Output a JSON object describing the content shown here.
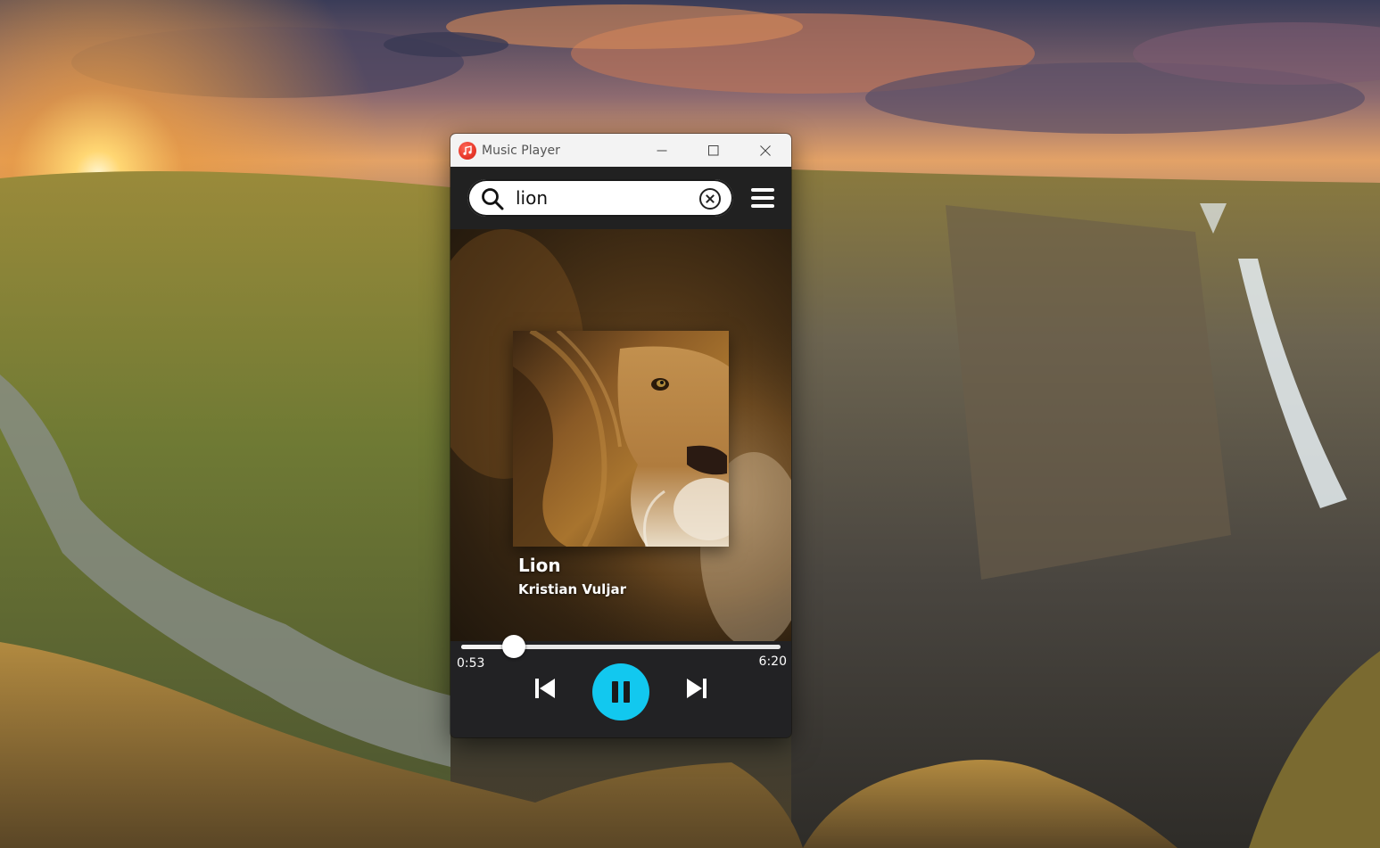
{
  "window": {
    "title": "Music Player"
  },
  "search": {
    "query": "lion",
    "placeholder": ""
  },
  "track": {
    "title": "Lion",
    "artist": "Kristian Vuljar"
  },
  "player": {
    "current_time": "0:53",
    "total_time": "6:20",
    "progress_fraction": 0.165,
    "state": "playing"
  },
  "icons": {
    "app": "music-note-icon",
    "minimize": "minimize-icon",
    "maximize": "maximize-icon",
    "close": "close-icon",
    "search": "search-icon",
    "clear": "clear-circle-x-icon",
    "menu": "hamburger-menu-icon",
    "previous": "skip-previous-icon",
    "pause": "pause-icon",
    "next": "skip-next-icon"
  },
  "colors": {
    "accent": "#12c8ef",
    "window_bg": "#222224",
    "titlebar_bg": "#f3f3f3"
  }
}
